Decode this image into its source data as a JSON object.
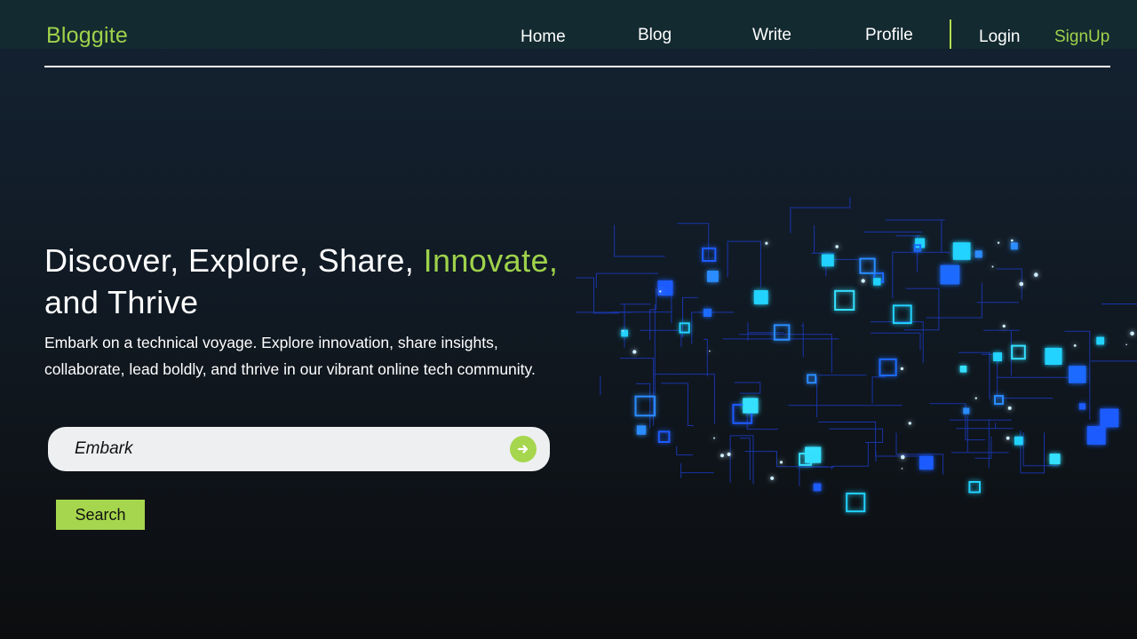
{
  "brand": {
    "name": "Bloggite"
  },
  "nav": {
    "home": "Home",
    "blog": "Blog",
    "write": "Write",
    "profile": "Profile",
    "login": "Login",
    "signup": "SignUp"
  },
  "hero": {
    "title_part1": "Discover, Explore, Share, ",
    "title_accent": "Innovate,",
    "title_part2": "and Thrive",
    "subtitle": "Embark on a technical voyage. Explore innovation, share insights, collaborate, lead boldly, and thrive in our vibrant online tech community."
  },
  "search": {
    "value": "Embark",
    "button_label": "Search"
  },
  "colors": {
    "accent": "#9fd24b",
    "button": "#a6d64d",
    "topbar": "#132a30",
    "background_top": "#142232",
    "background_bottom": "#0c0d0f",
    "circuit_blue": "#1f5bff",
    "circuit_cyan": "#22d3ff"
  },
  "icons": {
    "go": "arrow-right-circle-icon",
    "hero_art": "circuit-network-illustration"
  }
}
